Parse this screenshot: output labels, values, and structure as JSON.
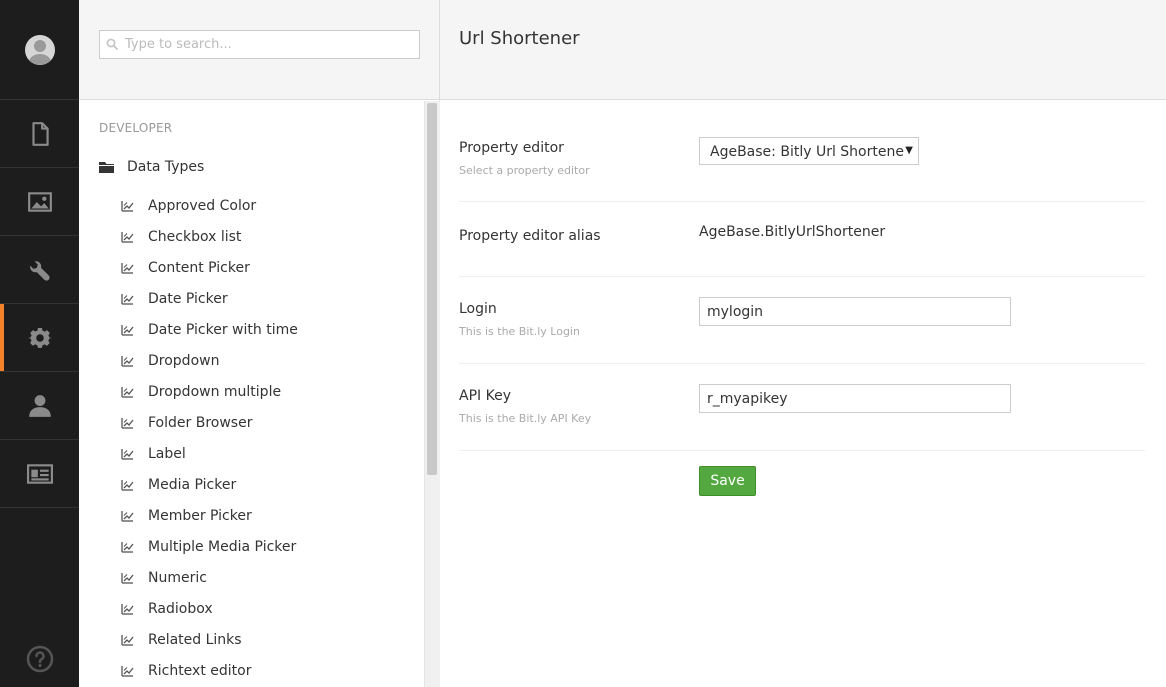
{
  "colors": {
    "nav_bg": "#1d1d1d",
    "active_indicator": "#f5822a",
    "save_button": "#53a93f"
  },
  "appnav": {
    "items": [
      {
        "icon": "document-icon"
      },
      {
        "icon": "image-icon"
      },
      {
        "icon": "wrench-icon"
      },
      {
        "icon": "gear-icon",
        "active": true
      },
      {
        "icon": "user-icon"
      },
      {
        "icon": "id-card-icon"
      }
    ],
    "help_icon": "help-icon"
  },
  "tree": {
    "search_placeholder": "Type to search...",
    "section_title": "DEVELOPER",
    "root_label": "Data Types",
    "items": [
      "Approved Color",
      "Checkbox list",
      "Content Picker",
      "Date Picker",
      "Date Picker with time",
      "Dropdown",
      "Dropdown multiple",
      "Folder Browser",
      "Label",
      "Media Picker",
      "Member Picker",
      "Multiple Media Picker",
      "Numeric",
      "Radiobox",
      "Related Links",
      "Richtext editor"
    ]
  },
  "editor": {
    "name": "Url Shortener",
    "property_editor": {
      "label": "Property editor",
      "description": "Select a property editor",
      "selected": "AgeBase: Bitly Url Shortene"
    },
    "alias": {
      "label": "Property editor alias",
      "value": "AgeBase.BitlyUrlShortener"
    },
    "login": {
      "label": "Login",
      "description": "This is the Bit.ly Login",
      "value": "mylogin"
    },
    "api_key": {
      "label": "API Key",
      "description": "This is the Bit.ly API Key",
      "value": "r_myapikey"
    },
    "save_label": "Save"
  }
}
